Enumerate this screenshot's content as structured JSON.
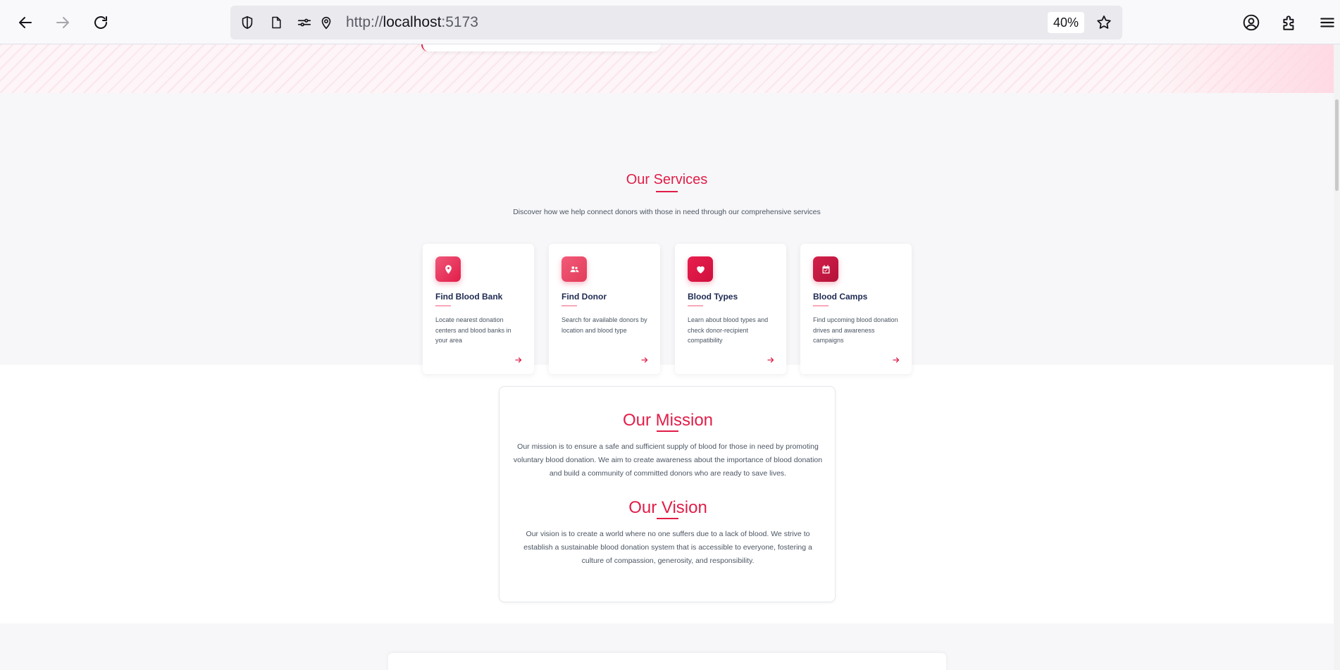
{
  "browser": {
    "url_scheme": "http://",
    "url_host": "localhost",
    "url_port": ":5173",
    "zoom": "40%"
  },
  "services": {
    "title_part1": "Our ",
    "title_part2": "Services",
    "subtitle": "Discover how we help connect donors with those in need through our comprehensive services",
    "cards": [
      {
        "title": "Find Blood Bank",
        "description": "Locate nearest donation centers and blood banks in your area",
        "icon": "map-pin-icon",
        "color": "#e8405f"
      },
      {
        "title": "Find Donor",
        "description": "Search for available donors by location and blood type",
        "icon": "users-icon",
        "color": "#ec4561"
      },
      {
        "title": "Blood Types",
        "description": "Learn about blood types and check donor-recipient compatibility",
        "icon": "heart-icon",
        "color": "#dc1446"
      },
      {
        "title": "Blood Camps",
        "description": "Find upcoming blood donation drives and awareness campaigns",
        "icon": "calendar-check-icon",
        "color": "#c8163f"
      }
    ]
  },
  "mission": {
    "title_part1": "Our ",
    "title_part2": "Mission",
    "text": "Our mission is to ensure a safe and sufficient supply of blood for those in need by promoting voluntary blood donation. We aim to create awareness about the importance of blood donation and build a community of committed donors who are ready to save lives."
  },
  "vision": {
    "title_part1": "Our ",
    "title_part2": "Vision",
    "text": "Our vision is to create a world where no one suffers due to a lack of blood. We strive to establish a sustainable blood donation system that is accessible to everyone, fostering a culture of compassion, generosity, and responsibility."
  },
  "colors": {
    "accent": "#e11d48",
    "heading_dark": "#1e2a52",
    "section_bg": "#f7f7f9"
  }
}
